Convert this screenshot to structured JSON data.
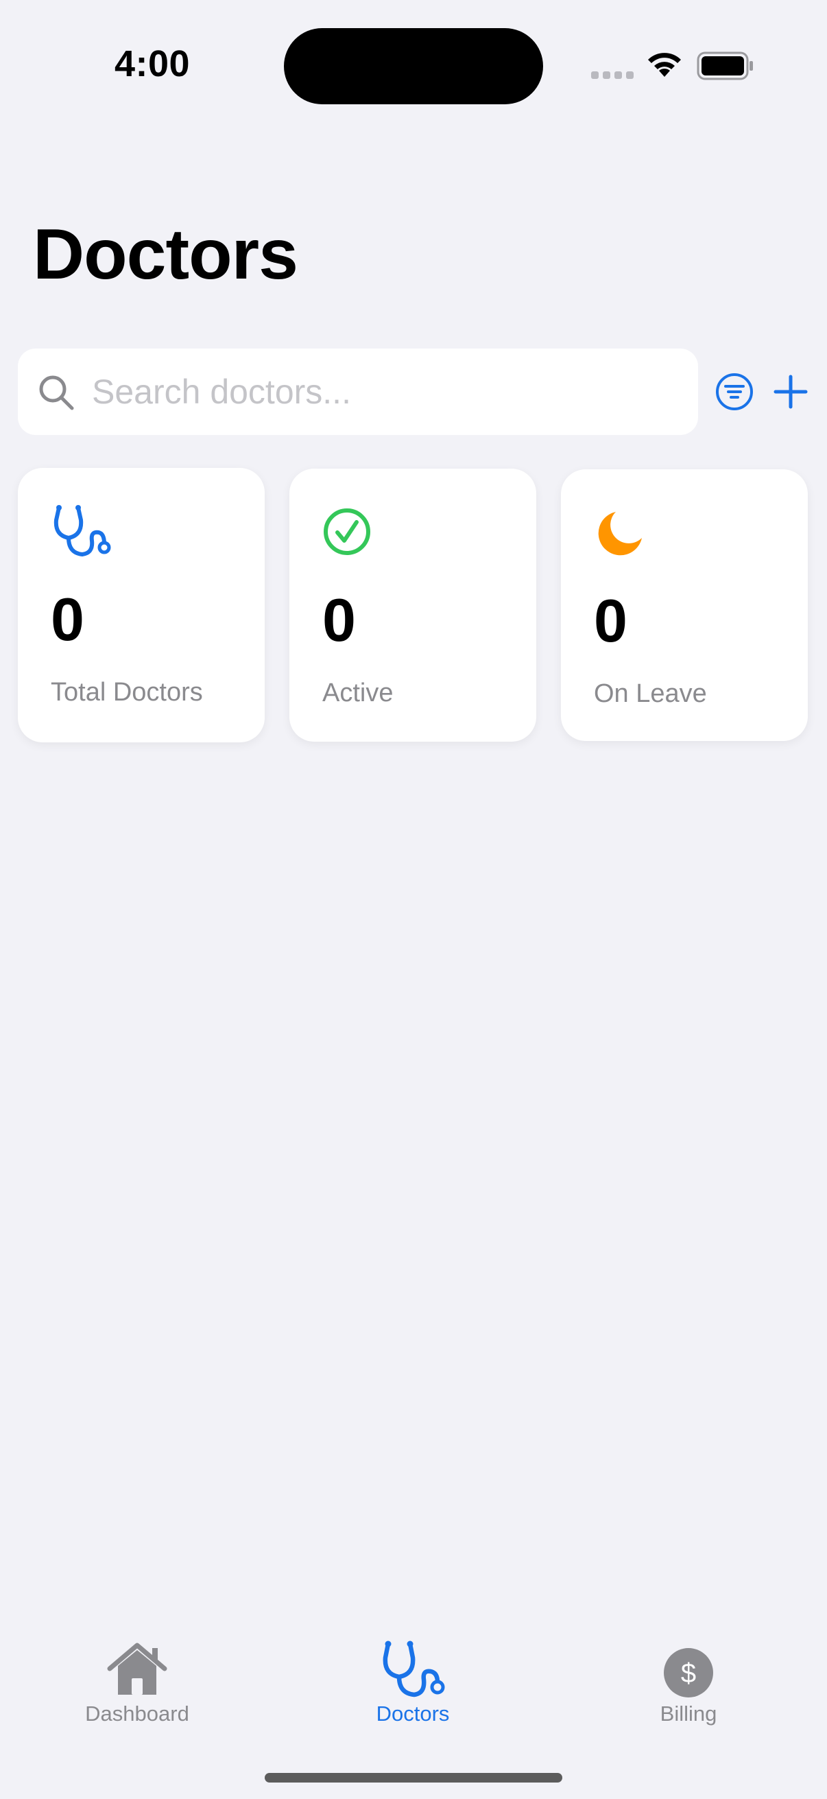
{
  "status_bar": {
    "time": "4:00"
  },
  "header": {
    "title": "Doctors"
  },
  "search": {
    "placeholder": "Search doctors...",
    "value": ""
  },
  "stats": [
    {
      "value": "0",
      "label": "Total Doctors",
      "icon": "stethoscope-icon",
      "color": "#1a73e8"
    },
    {
      "value": "0",
      "label": "Active",
      "icon": "checkmark-circle-icon",
      "color": "#34c759"
    },
    {
      "value": "0",
      "label": "On Leave",
      "icon": "moon-icon",
      "color": "#ff9500"
    }
  ],
  "tab_bar": {
    "items": [
      {
        "label": "Dashboard",
        "icon": "house-icon",
        "active": false
      },
      {
        "label": "Doctors",
        "icon": "stethoscope-icon",
        "active": true
      },
      {
        "label": "Billing",
        "icon": "dollar-circle-icon",
        "active": false
      }
    ]
  },
  "colors": {
    "accent": "#1a73e8",
    "background": "#f2f2f7",
    "secondary_text": "#8a8a8e"
  }
}
